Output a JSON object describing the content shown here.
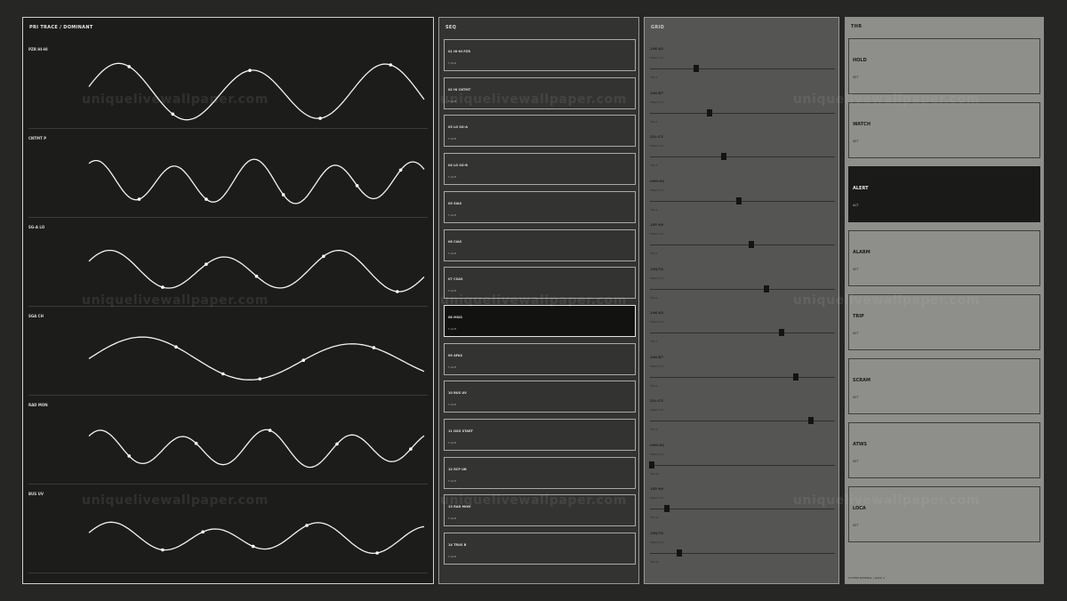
{
  "trace_panel": {
    "title": "PRI TRACE / DOMINANT",
    "traces": [
      {
        "label": "PZR HI-HI",
        "points": [
          [
            0.12,
            0.45
          ],
          [
            0.25,
            0.38
          ],
          [
            0.48,
            0.74
          ],
          [
            0.69,
            0.77
          ],
          [
            0.9,
            0.52
          ]
        ],
        "amplitude": 0.3,
        "freq": 2.5,
        "phase": 0.2
      },
      {
        "label": "CNTMT P",
        "points": [
          [
            0.15,
            0.72
          ],
          [
            0.35,
            0.54
          ],
          [
            0.58,
            0.68
          ],
          [
            0.8,
            0.42
          ],
          [
            0.93,
            0.63
          ]
        ],
        "amplitude": 0.22,
        "freq": 4.2,
        "phase": 1.1
      },
      {
        "label": "SG-A LO",
        "points": [
          [
            0.22,
            0.48
          ],
          [
            0.35,
            0.66
          ],
          [
            0.5,
            0.43
          ],
          [
            0.7,
            0.56
          ],
          [
            0.92,
            0.61
          ]
        ],
        "amplitude": 0.2,
        "freq": 2.9,
        "phase": 0.5
      },
      {
        "label": "SGA CH",
        "points": [
          [
            0.26,
            0.43
          ],
          [
            0.4,
            0.69
          ],
          [
            0.51,
            0.77
          ],
          [
            0.64,
            0.4
          ],
          [
            0.85,
            0.74
          ]
        ],
        "amplitude": 0.22,
        "freq": 1.6,
        "phase": 0.0
      },
      {
        "label": "RAD MON",
        "points": [
          [
            0.12,
            0.65
          ],
          [
            0.32,
            0.61
          ],
          [
            0.54,
            0.69
          ],
          [
            0.74,
            0.47
          ],
          [
            0.96,
            0.67
          ]
        ],
        "amplitude": 0.18,
        "freq": 4.0,
        "phase": 0.8
      },
      {
        "label": "BUS UV",
        "points": [
          [
            0.22,
            0.67
          ],
          [
            0.34,
            0.56
          ],
          [
            0.49,
            0.71
          ],
          [
            0.65,
            0.53
          ],
          [
            0.86,
            0.54
          ]
        ],
        "amplitude": 0.14,
        "freq": 3.2,
        "phase": 0.3
      }
    ]
  },
  "seq_panel": {
    "title": "SEQ",
    "active_index": 7,
    "steps": [
      {
        "name": "01 HI-HI PZR",
        "tag": "T+0:6"
      },
      {
        "name": "02 HI CNTMT",
        "tag": "T+0:8"
      },
      {
        "name": "03 LO SG-A",
        "tag": "T+0:8"
      },
      {
        "name": "04 LO SG-B",
        "tag": "T+0:8"
      },
      {
        "name": "05 SIAS",
        "tag": "T+0:8"
      },
      {
        "name": "06 CIAS",
        "tag": "T+0:8"
      },
      {
        "name": "07 CSAS",
        "tag": "T+0:8"
      },
      {
        "name": "08 MSIS",
        "tag": "T+0:8"
      },
      {
        "name": "09 AFAS",
        "tag": "T+0:8"
      },
      {
        "name": "10 BUS UV",
        "tag": "T+0:8"
      },
      {
        "name": "11 DSG START",
        "tag": "T+0:8"
      },
      {
        "name": "12 RCP UB",
        "tag": "T+0:8"
      },
      {
        "name": "13 RAD MON",
        "tag": "T+0:8"
      },
      {
        "name": "14 TRUS B",
        "tag": "T+0:8"
      }
    ]
  },
  "grp_panel": {
    "title": "GRID",
    "rows": [
      {
        "name": "14K-A2",
        "desc": "RNGE 0-10",
        "tag": "TRK 1",
        "value": 0.25
      },
      {
        "name": "14K-B7",
        "desc": "RNGE 0-10",
        "tag": "TRK 2",
        "value": 0.32
      },
      {
        "name": "21L-C3",
        "desc": "RNGE 0-10",
        "tag": "TRK 3",
        "value": 0.4
      },
      {
        "name": "09M-D1",
        "desc": "RNGE 0-10",
        "tag": "TRK 4",
        "value": 0.48
      },
      {
        "name": "15P-A9",
        "desc": "RNGE 0-10",
        "tag": "TRK 5",
        "value": 0.55
      },
      {
        "name": "19Q-T4",
        "desc": "RNGE 0-10",
        "tag": "TRK 6",
        "value": 0.63
      },
      {
        "name": "14K-A3",
        "desc": "RNGE 0-10",
        "tag": "TRK 7",
        "value": 0.71
      },
      {
        "name": "14K-B7",
        "desc": "RNGE 0-10",
        "tag": "TRK 8",
        "value": 0.79
      },
      {
        "name": "21L-C3",
        "desc": "RNGE 0-10",
        "tag": "TRK 9",
        "value": 0.87
      },
      {
        "name": "09M-D1",
        "desc": "RNGE 0-10",
        "tag": "TRK 10",
        "value": 0.01
      },
      {
        "name": "15P-A9",
        "desc": "RNGE 0-10",
        "tag": "TRK 11",
        "value": 0.09
      },
      {
        "name": "19Q-T4",
        "desc": "RNGE 0-10",
        "tag": "TRK 12",
        "value": 0.16
      }
    ]
  },
  "thr_panel": {
    "title": "THR",
    "active_index": 2,
    "levels": [
      {
        "name": "HOLD",
        "state": "SET"
      },
      {
        "name": "WATCH",
        "state": "SET"
      },
      {
        "name": "ALERT",
        "state": "ACT"
      },
      {
        "name": "ALARM",
        "state": "SET"
      },
      {
        "name": "TRIP",
        "state": "SET"
      },
      {
        "name": "SCRAM",
        "state": "SET"
      },
      {
        "name": "ATWS",
        "state": "SET"
      },
      {
        "name": "LOCA",
        "state": "SET"
      }
    ],
    "footer": "SYSTEM NOMINAL / RACK 4"
  },
  "watermark": "uniquelivewallpaper.com",
  "colors": {
    "trace": "#f4f4f0",
    "marker": "#ffffff"
  }
}
